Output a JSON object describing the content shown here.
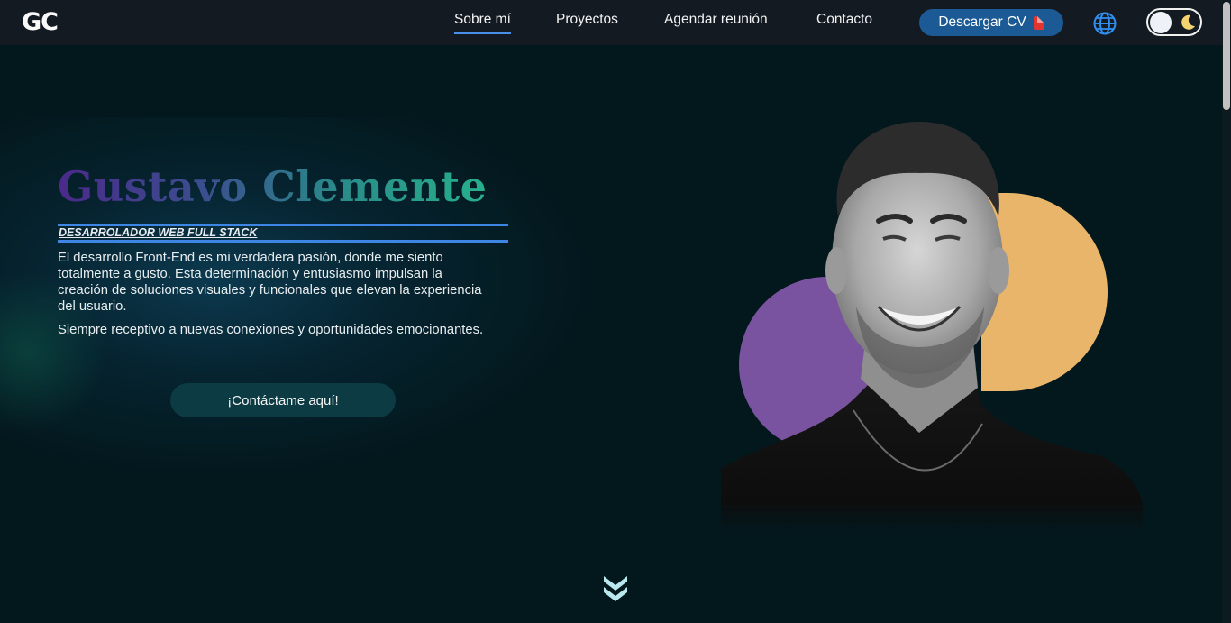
{
  "nav": {
    "logo": "GC",
    "links": [
      "Sobre mí",
      "Proyectos",
      "Agendar reunión",
      "Contacto"
    ],
    "cv_label": "Descargar CV",
    "icons": {
      "cv": "pdf-icon",
      "language": "globe-icon",
      "theme": "moon-icon"
    }
  },
  "hero": {
    "name_first": "Gustavo",
    "name_last": "Clemente",
    "role": "DESARROLADOR WEB FULL STACK",
    "description": "El desarrollo Front-End es mi verdadera pasión, donde me siento totalmente a gusto. Esta determinación y entusiasmo impulsan la creación de soluciones visuales y funcionales que elevan la experiencia del usuario.",
    "description2": "Siempre receptivo a nuevas conexiones y oportunidades emocionantes.",
    "cta_label": "¡Contáctame aquí!"
  },
  "colors": {
    "background": "#03181d",
    "navbar": "#131a22",
    "accent_blue": "#1b5a94",
    "underline_blue": "#3e86e4",
    "purple": "#7a53a0",
    "orange": "#e8b56a",
    "cta": "#0c3b43"
  },
  "scroll_icon": "chevron-double-down-icon"
}
